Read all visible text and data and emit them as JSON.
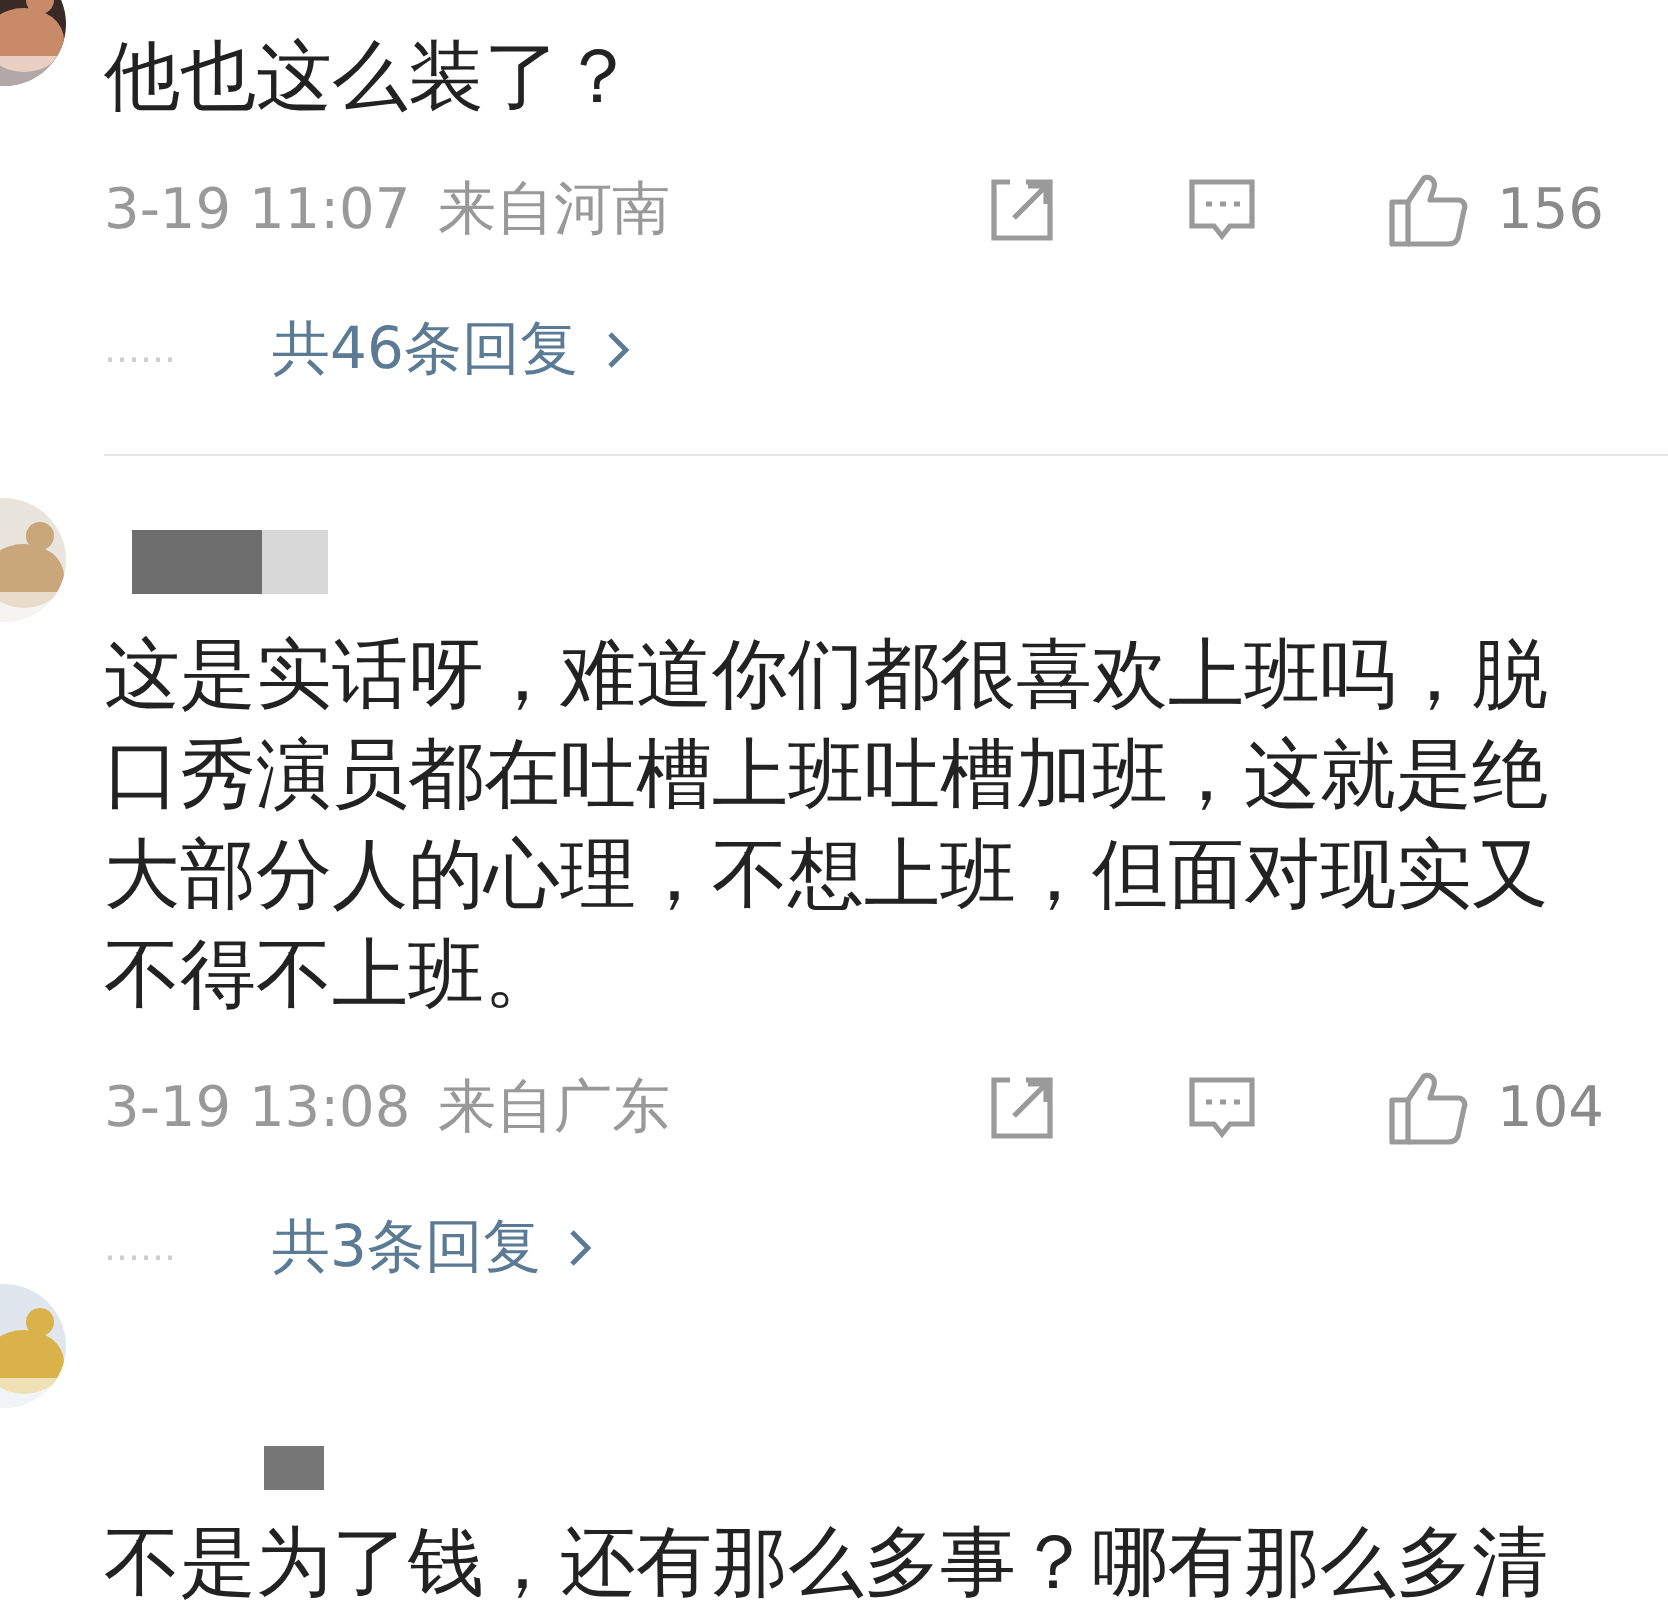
{
  "comments": [
    {
      "name_hidden": false,
      "text": "他也这么装了？",
      "time": "3-19 11:07",
      "location": "来自河南",
      "likes": "156",
      "replies_dots": "……",
      "replies": "共46条回复",
      "divider": true
    },
    {
      "name_hidden": true,
      "text": "这是实话呀，难道你们都很喜欢上班吗，脱口秀演员都在吐槽上班吐槽加班，这就是绝大部分人的心理，不想上班，但面对现实又不得不上班。",
      "time": "3-19 13:08",
      "location": "来自广东",
      "likes": "104",
      "replies_dots": "……",
      "replies": "共3条回复",
      "divider": false
    },
    {
      "name_hidden": true,
      "text": "不是为了钱，还有那么多事？哪有那么多清"
    }
  ]
}
